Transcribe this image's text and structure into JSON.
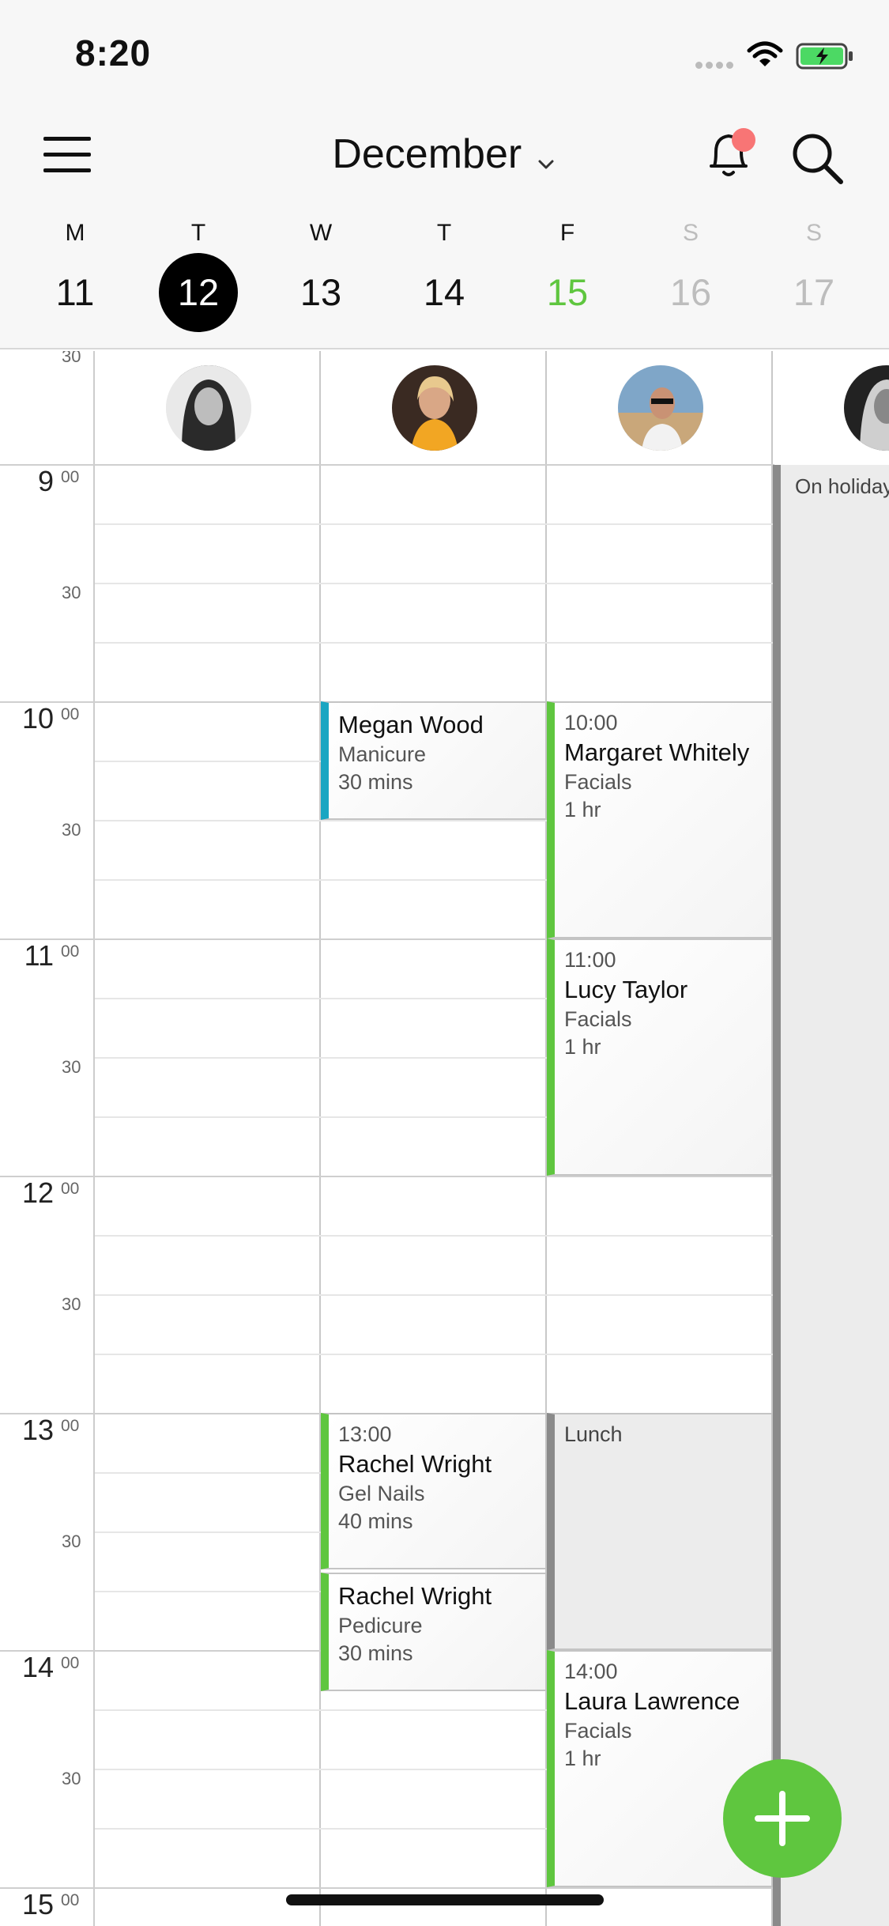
{
  "status_bar": {
    "time": "8:20"
  },
  "header": {
    "month": "December"
  },
  "week": [
    {
      "letter": "M",
      "date": "11",
      "state": "normal"
    },
    {
      "letter": "T",
      "date": "12",
      "state": "selected"
    },
    {
      "letter": "W",
      "date": "13",
      "state": "normal"
    },
    {
      "letter": "T",
      "date": "14",
      "state": "normal"
    },
    {
      "letter": "F",
      "date": "15",
      "state": "today"
    },
    {
      "letter": "S",
      "date": "16",
      "state": "muted"
    },
    {
      "letter": "S",
      "date": "17",
      "state": "muted"
    }
  ],
  "time_gutter": {
    "top_half": "30",
    "hours": [
      "9",
      "10",
      "11",
      "12",
      "13",
      "14",
      "15"
    ],
    "minute_sup": "00",
    "half": "30"
  },
  "staff_columns": {
    "holiday_label": "On holiday"
  },
  "appointments": {
    "megan": {
      "name": "Megan Wood",
      "service": "Manicure",
      "duration": "30 mins"
    },
    "margaret": {
      "time": "10:00",
      "name": "Margaret Whitely",
      "service": "Facials",
      "duration": "1 hr"
    },
    "lucy": {
      "time": "11:00",
      "name": "Lucy Taylor",
      "service": "Facials",
      "duration": "1 hr"
    },
    "rachel1": {
      "time": "13:00",
      "name": "Rachel Wright",
      "service": "Gel Nails",
      "duration": "40 mins"
    },
    "rachel2": {
      "name": "Rachel Wright",
      "service": "Pedicure",
      "duration": "30 mins"
    },
    "lunch": {
      "label": "Lunch"
    },
    "laura": {
      "time": "14:00",
      "name": "Laura Lawrence",
      "service": "Facials",
      "duration": "1 hr"
    }
  },
  "colors": {
    "accent_green": "#5fc63f",
    "accent_teal": "#1aa6c2",
    "notification": "#f87575",
    "selected_day": "#000000"
  }
}
